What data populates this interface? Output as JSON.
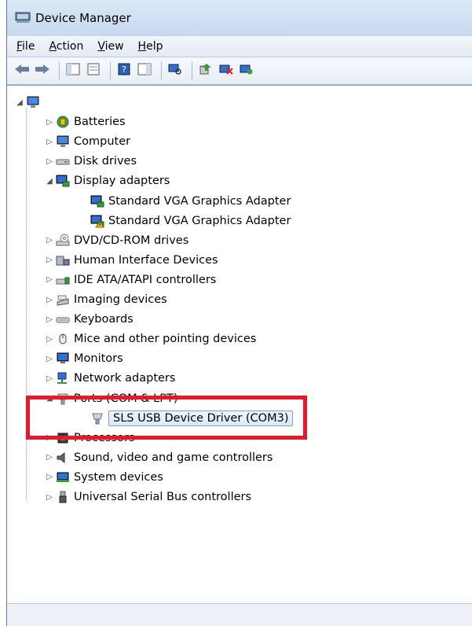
{
  "window": {
    "title": "Device Manager"
  },
  "menu": [
    {
      "label": "File",
      "key": "F",
      "rest": "ile"
    },
    {
      "label": "Action",
      "key": "A",
      "rest": "ction"
    },
    {
      "label": "View",
      "key": "V",
      "rest": "iew"
    },
    {
      "label": "Help",
      "key": "H",
      "rest": "elp"
    }
  ],
  "toolbar_icons": [
    "back-icon",
    "forward-icon",
    "show-hide-tree-icon",
    "properties-icon",
    "help-icon",
    "action-pane-icon",
    "scan-hardware-icon",
    "update-driver-icon",
    "disable-icon",
    "uninstall-icon"
  ],
  "tree": {
    "root_icon": "computer-icon",
    "items": [
      {
        "label": "Batteries",
        "icon": "battery-icon",
        "expanded": false
      },
      {
        "label": "Computer",
        "icon": "computer-icon",
        "expanded": false
      },
      {
        "label": "Disk drives",
        "icon": "disk-drive-icon",
        "expanded": false
      },
      {
        "label": "Display adapters",
        "icon": "display-adapter-icon",
        "expanded": true,
        "children": [
          {
            "label": "Standard VGA Graphics Adapter",
            "icon": "display-adapter-icon",
            "warning": false
          },
          {
            "label": "Standard VGA Graphics Adapter",
            "icon": "display-adapter-icon",
            "warning": true
          }
        ]
      },
      {
        "label": "DVD/CD-ROM drives",
        "icon": "dvd-drive-icon",
        "expanded": false
      },
      {
        "label": "Human Interface Devices",
        "icon": "hid-icon",
        "expanded": false
      },
      {
        "label": "IDE ATA/ATAPI controllers",
        "icon": "ide-controller-icon",
        "expanded": false
      },
      {
        "label": "Imaging devices",
        "icon": "scanner-icon",
        "expanded": false
      },
      {
        "label": "Keyboards",
        "icon": "keyboard-icon",
        "expanded": false
      },
      {
        "label": "Mice and other pointing devices",
        "icon": "mouse-icon",
        "expanded": false
      },
      {
        "label": "Monitors",
        "icon": "monitor-icon",
        "expanded": false
      },
      {
        "label": "Network adapters",
        "icon": "network-adapter-icon",
        "expanded": false
      },
      {
        "label": "Ports (COM & LPT)",
        "icon": "port-icon",
        "expanded": true,
        "children": [
          {
            "label": "SLS USB Device Driver (COM3)",
            "icon": "port-icon",
            "selected": true
          }
        ]
      },
      {
        "label": "Processors",
        "icon": "processor-icon",
        "expanded": false
      },
      {
        "label": "Sound, video and game controllers",
        "icon": "speaker-icon",
        "expanded": false
      },
      {
        "label": "System devices",
        "icon": "system-device-icon",
        "expanded": false
      },
      {
        "label": "Universal Serial Bus controllers",
        "icon": "usb-icon",
        "expanded": false
      }
    ]
  },
  "annotation": {
    "color": "#e8182b"
  }
}
